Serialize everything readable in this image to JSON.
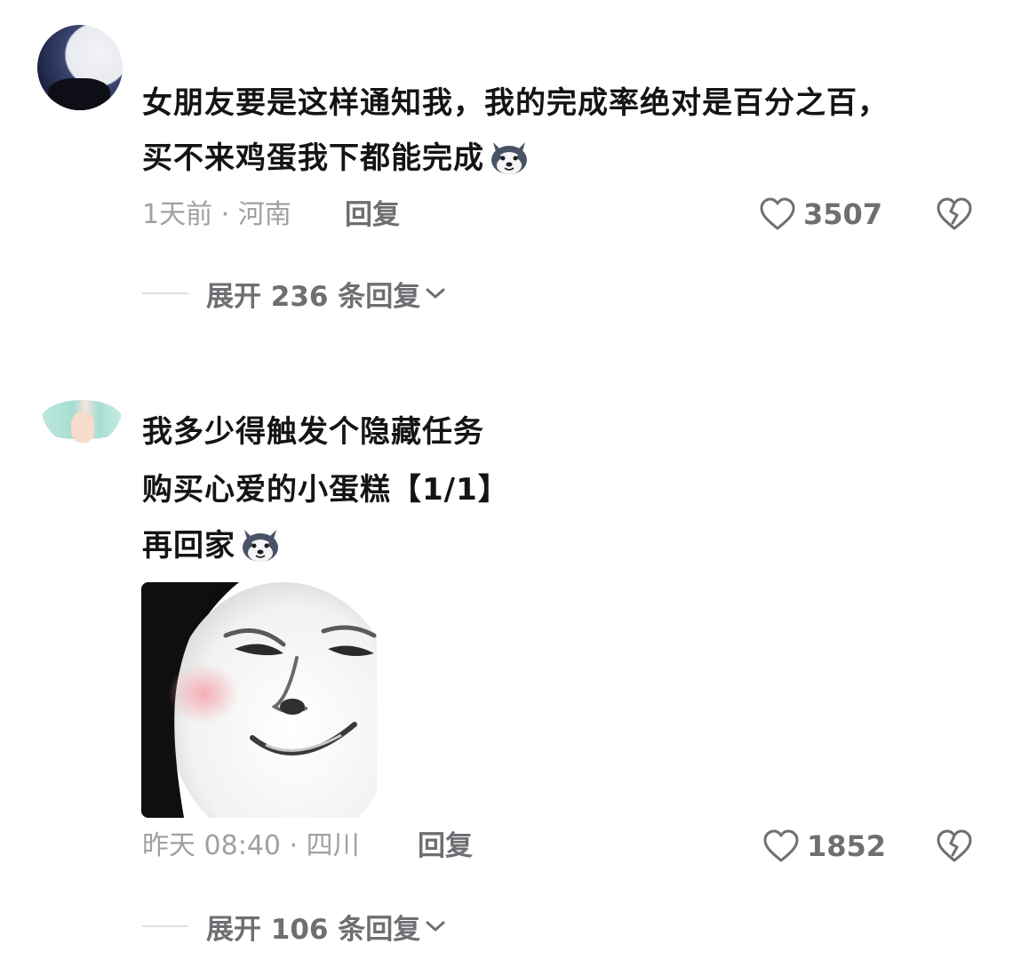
{
  "comments": [
    {
      "lines": [
        "女朋友要是这样通知我，我的完成率绝对是百分之百，",
        "买不来鸡蛋我下都能完成"
      ],
      "time_location": "1天前 · 河南",
      "reply_label": "回复",
      "likes": "3507",
      "expand_label": "展开 236 条回复",
      "emoji": "husky-dog-emoji"
    },
    {
      "lines": [
        "我多少得触发个隐藏任务",
        "购买心爱的小蛋糕【1/1】",
        "再回家"
      ],
      "time_location": "昨天 08:40 · 四川",
      "reply_label": "回复",
      "likes": "1852",
      "expand_label": "展开 106 条回复",
      "emoji": "husky-dog-emoji",
      "sticker": "smirking-face-meme-sticker"
    }
  ],
  "icons": {
    "like": "heart-outline-icon",
    "dislike": "broken-heart-icon",
    "expand": "chevron-down-icon"
  },
  "colors": {
    "text": "#141414",
    "meta": "#a0a0a4",
    "action": "#6e6e73",
    "blush": "#f4a9b0"
  }
}
